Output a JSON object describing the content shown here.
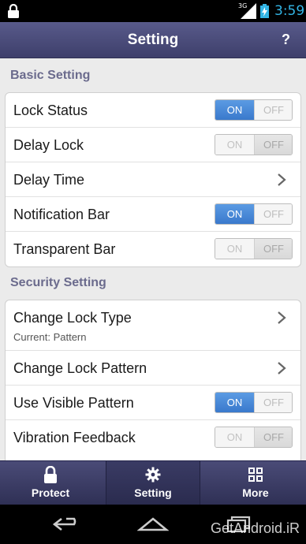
{
  "status_bar": {
    "time": "3:59",
    "network": "3G"
  },
  "header": {
    "title": "Setting",
    "help_label": "?"
  },
  "sections": {
    "basic": {
      "title": "Basic Setting",
      "rows": [
        {
          "label": "Lock Status",
          "toggle": "on"
        },
        {
          "label": "Delay Lock",
          "toggle": "off"
        },
        {
          "label": "Delay Time"
        },
        {
          "label": "Notification Bar",
          "toggle": "on"
        },
        {
          "label": "Transparent Bar",
          "toggle": "off"
        }
      ]
    },
    "security": {
      "title": "Security Setting",
      "rows": [
        {
          "label": "Change Lock Type",
          "sub": "Current: Pattern"
        },
        {
          "label": "Change Lock Pattern"
        },
        {
          "label": "Use Visible Pattern",
          "toggle": "on"
        },
        {
          "label": "Vibration Feedback",
          "toggle": "off"
        }
      ]
    }
  },
  "toggle_labels": {
    "on": "ON",
    "off": "OFF"
  },
  "tabs": [
    {
      "label": "Protect",
      "icon": "lock-icon"
    },
    {
      "label": "Setting",
      "icon": "gear-icon",
      "active": true
    },
    {
      "label": "More",
      "icon": "grid-icon"
    }
  ],
  "watermark": "GetAndroid.iR",
  "colors": {
    "accent": "#3a79cc",
    "header": "#4a4b77",
    "section_title": "#6b6b8d"
  }
}
